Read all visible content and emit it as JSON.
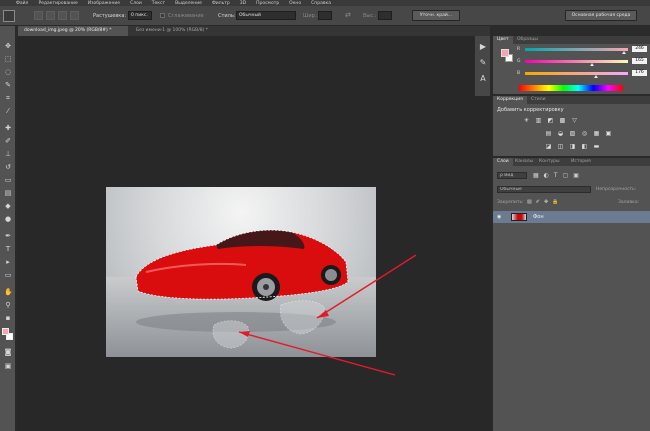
{
  "menubar": {
    "items": [
      "Файл",
      "Редактирование",
      "Изображение",
      "Слои",
      "Текст",
      "Выделение",
      "Фильтр",
      "3D",
      "Просмотр",
      "Окно",
      "Справка"
    ]
  },
  "options": {
    "feather_label": "Растушевка:",
    "feather_value": "0 пикс.",
    "antialias_label": "Сглаживание",
    "style_label": "Стиль:",
    "style_value": "Обычный",
    "width_label": "Шир.:",
    "height_label": "Выс.:",
    "refine_button": "Уточн. край...",
    "workspace_button": "Основная рабочая среда"
  },
  "tabs": [
    {
      "label": "download_img.jpeg @ 20% (RGB/8#) *",
      "active": true
    },
    {
      "label": "Без имени-1 @ 100% (RGB/8) *",
      "active": false
    }
  ],
  "color_panel": {
    "tabs": [
      "Цвет",
      "Образцы"
    ],
    "channels": [
      {
        "label": "R",
        "value": "246",
        "fraction": 0.96,
        "gradient": "linear-gradient(90deg,#00a8b0,#f6a8b0)"
      },
      {
        "label": "G",
        "value": "165",
        "fraction": 0.65,
        "gradient": "linear-gradient(90deg,#f600b0,#f6ffb0)"
      },
      {
        "label": "B",
        "value": "176",
        "fraction": 0.69,
        "gradient": "linear-gradient(90deg,#f6a800,#f6a8ff)"
      }
    ],
    "foreground": "#f6a5b0",
    "background": "#ffffff"
  },
  "adjustments_panel": {
    "tabs": [
      "Коррекция",
      "Стили"
    ],
    "title": "Добавить корректировку",
    "row1": [
      "☀",
      "▥",
      "◩",
      "▩",
      "▽"
    ],
    "row2": [
      "▤",
      "◒",
      "▧",
      "◎",
      "▦",
      "▣"
    ],
    "row3": [
      "◪",
      "◫",
      "◨",
      "◧",
      "▬"
    ]
  },
  "layers_panel": {
    "tabs": [
      "Слои",
      "Каналы",
      "Контуры",
      "История"
    ],
    "kind_label": "ρ Вид",
    "blend_mode": "Обычные",
    "opacity_label": "Непрозрачность:",
    "lock_label": "Закрепить:",
    "fill_label": "Заливка:",
    "layer_name": "Фон"
  },
  "colors": {
    "accent_layer": "#6b7c92",
    "annotation_red": "#e21b2b",
    "car_red": "#d90d0d"
  }
}
